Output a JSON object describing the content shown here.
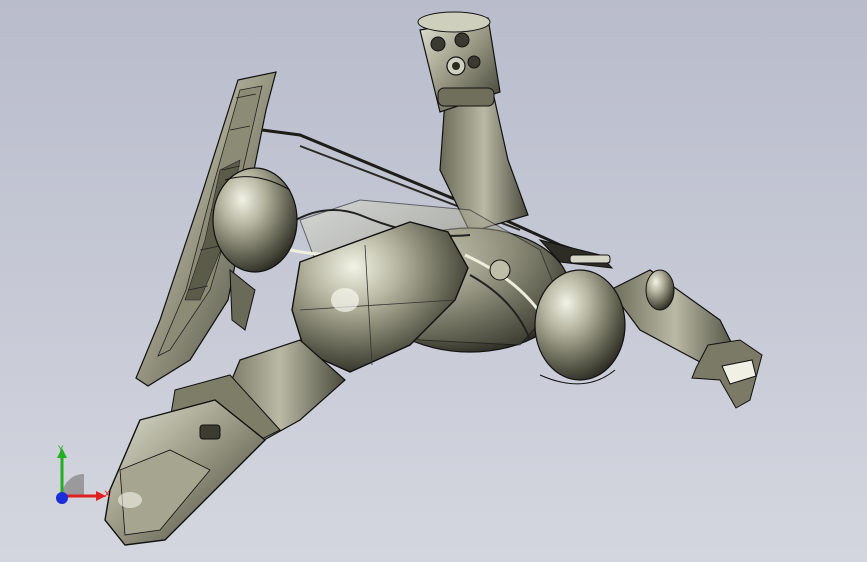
{
  "viewport": {
    "background_top": "#b9bccb",
    "background_bottom": "#d4d6df"
  },
  "model": {
    "shade_light": "#d7d7c8",
    "shade_mid": "#9b9b86",
    "shade_dark": "#2f2f27",
    "edge": "#111111"
  },
  "triad": {
    "x_label": "X",
    "y_label": "Y",
    "x_color": "#e02020",
    "y_color": "#22b022",
    "z_color": "#1a2fd8"
  }
}
